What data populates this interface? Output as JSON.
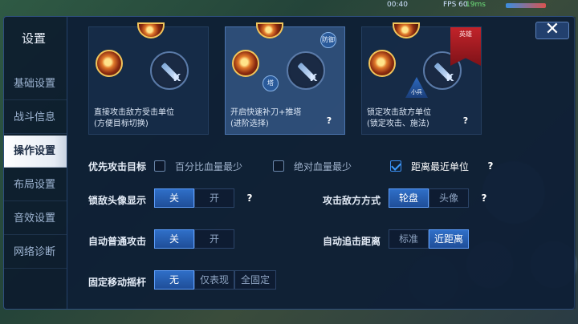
{
  "hud": {
    "time": "00:40",
    "fps": "FPS 60",
    "ping": "19ms"
  },
  "sidebar": {
    "title": "设置",
    "items": [
      {
        "label": "基础设置"
      },
      {
        "label": "战斗信息"
      },
      {
        "label": "操作设置",
        "active": true
      },
      {
        "label": "布局设置"
      },
      {
        "label": "音效设置"
      },
      {
        "label": "网络诊断"
      }
    ]
  },
  "close_label": "✕",
  "cards": [
    {
      "caption": "直接攻击敌方受击单位\n(方便目标切换)",
      "selected": false
    },
    {
      "caption": "开启快速补刀+推塔\n(进阶选择)",
      "selected": true,
      "help": "?",
      "badge_top": "防御",
      "badge_mid": "塔"
    },
    {
      "caption": "锁定攻击敌方单位\n(锁定攻击、施法)",
      "selected": false,
      "help": "?",
      "hero_tag": "英雄",
      "minion_tag": "小兵"
    }
  ],
  "priority": {
    "label": "优先攻击目标",
    "options": [
      {
        "label": "百分比血量最少",
        "checked": false
      },
      {
        "label": "绝对血量最少",
        "checked": false
      },
      {
        "label": "距离最近单位",
        "checked": true
      }
    ],
    "help": "?"
  },
  "lock_avatar": {
    "label": "锁敌头像显示",
    "options": [
      "关",
      "开"
    ],
    "selected": 0,
    "help": "?"
  },
  "attack_mode": {
    "label": "攻击敌方方式",
    "options": [
      "轮盘",
      "头像"
    ],
    "selected": 0,
    "help": "?"
  },
  "auto_attack": {
    "label": "自动普通攻击",
    "options": [
      "关",
      "开"
    ],
    "selected": 0
  },
  "auto_chase": {
    "label": "自动追击距离",
    "options": [
      "标准",
      "近距离"
    ],
    "selected": 1
  },
  "joystick": {
    "label": "固定移动摇杆",
    "options": [
      "无",
      "仅表现",
      "全固定"
    ],
    "selected": 0
  },
  "colors": {
    "accent": "#2f6fc8",
    "panel": "#0a182c",
    "active_tab": "#ffffff"
  }
}
